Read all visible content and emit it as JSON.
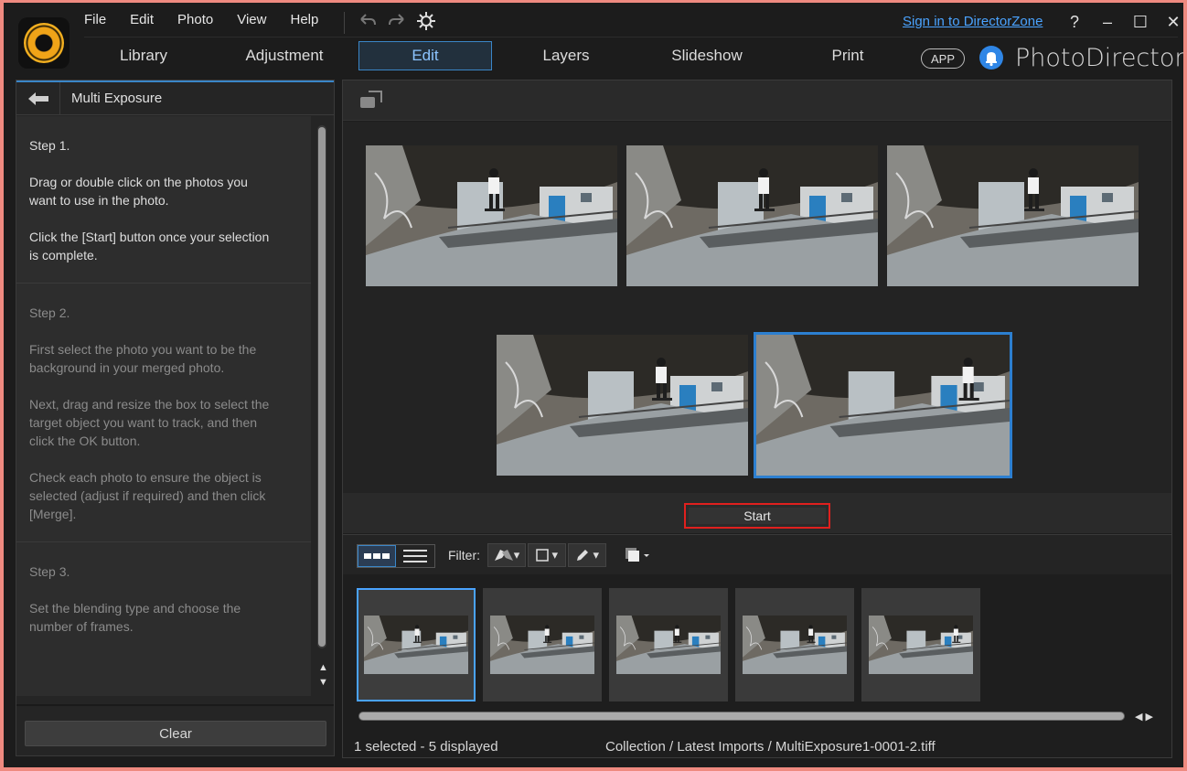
{
  "menu": [
    "File",
    "Edit",
    "Photo",
    "View",
    "Help"
  ],
  "signin": "Sign in to DirectorZone",
  "window_controls": {
    "help": "?",
    "minimize": "–",
    "maximize": "☐",
    "close": "✕"
  },
  "tabs": [
    {
      "label": "Library",
      "active": false
    },
    {
      "label": "Adjustment",
      "active": false
    },
    {
      "label": "Edit",
      "active": true
    },
    {
      "label": "Layers",
      "active": false
    },
    {
      "label": "Slideshow",
      "active": false
    },
    {
      "label": "Print",
      "active": false
    }
  ],
  "app_badge": "APP",
  "brand": "PhotoDirector",
  "left_panel": {
    "title": "Multi Exposure",
    "steps": [
      {
        "title": "Step 1.",
        "paragraphs": [
          "Drag or double click on the photos you\nwant to use in the photo.",
          "Click the [Start] button once your selection\nis complete."
        ],
        "active": true
      },
      {
        "title": "Step 2.",
        "paragraphs": [
          "First select the photo you want to be the\nbackground in your merged photo.",
          "Next, drag and resize the box to select the\ntarget object you want to track, and then\nclick the OK button.",
          "Check each photo to ensure the object is\nselected (adjust if required) and then click\n[Merge]."
        ],
        "active": false
      },
      {
        "title": "Step 3.",
        "paragraphs": [
          "Set the blending type and choose the\nnumber of frames."
        ],
        "active": false
      }
    ],
    "clear_label": "Clear"
  },
  "start_label": "Start",
  "filter_label": "Filter:",
  "status": {
    "selection": "1 selected - 5 displayed",
    "path": "Collection / Latest Imports / MultiExposure1-0001-2.tiff"
  },
  "colors": {
    "accent": "#3a86c8",
    "highlight_box": "#e0201e",
    "link": "#4aa3ff"
  }
}
